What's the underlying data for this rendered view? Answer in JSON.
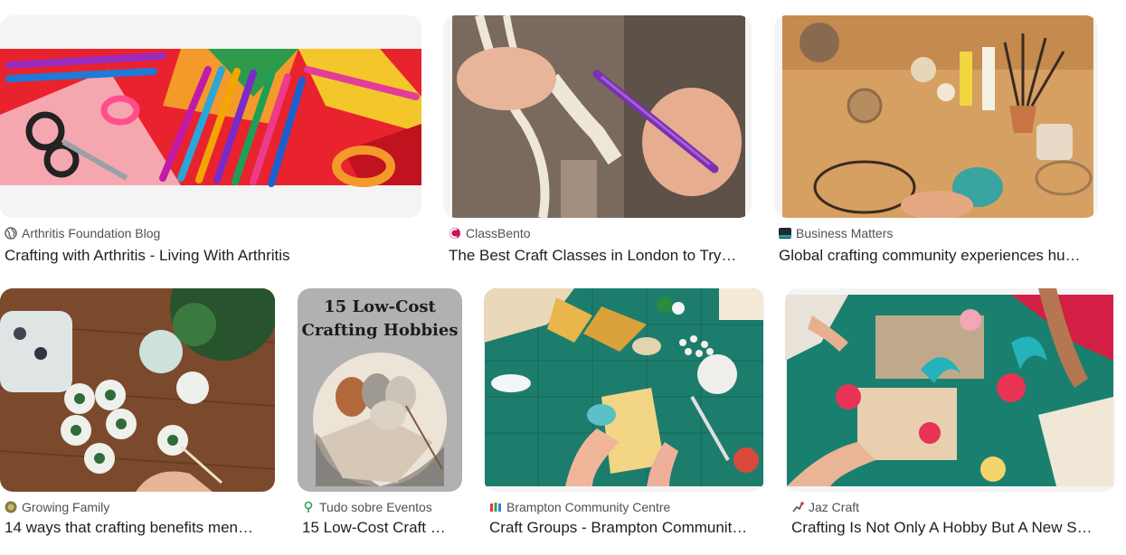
{
  "results": [
    {
      "source": "Arthritis Foundation Blog",
      "title": "Crafting with Arthritis - Living With Arthritis",
      "icon": "globe-icon"
    },
    {
      "source": "ClassBento",
      "title": "The Best Craft Classes in London to Try…",
      "icon": "classbento-logo-icon"
    },
    {
      "source": "Business Matters",
      "title": "Global crafting community experiences hu…",
      "icon": "business-matters-logo-icon"
    },
    {
      "source": "Growing Family",
      "title": "14 ways that crafting benefits men…",
      "icon": "growing-family-logo-icon"
    },
    {
      "source": "Tudo sobre Eventos",
      "title": "15 Low-Cost Craft …",
      "icon": "tudo-sobre-eventos-logo-icon",
      "image_text": [
        "15 Low-Cost",
        "Crafting Hobbies"
      ]
    },
    {
      "source": "Brampton Community Centre",
      "title": "Craft Groups - Brampton Communit…",
      "icon": "brampton-logo-icon"
    },
    {
      "source": "Jaz Craft",
      "title": "Crafting Is Not Only A Hobby But A New S…",
      "icon": "jaz-craft-logo-icon"
    }
  ]
}
